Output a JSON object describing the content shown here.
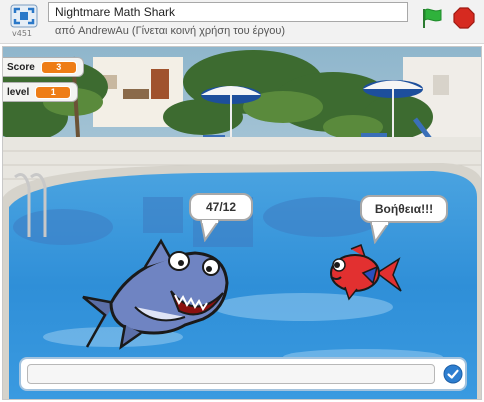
{
  "project": {
    "title": "Nightmare Math Shark",
    "byline": "από AndrewAu (Γίνεται κοινή χρήση του έργου)",
    "version": "v451"
  },
  "controls": {
    "fullscreen_icon": "fullscreen-icon",
    "green_flag_icon": "green-flag-icon",
    "stop_icon": "stop-sign-icon",
    "green_flag_color": "#2fb23c",
    "stop_color": "#d62a20"
  },
  "monitors": [
    {
      "label": "Score",
      "value": "3"
    },
    {
      "label": "level",
      "value": "1"
    }
  ],
  "monitor_color": "#ee7d16",
  "speech": {
    "shark": "47/12",
    "fish": "Βοήθεια!!!"
  },
  "ask": {
    "value": "",
    "ok_icon": "checkmark-icon"
  }
}
